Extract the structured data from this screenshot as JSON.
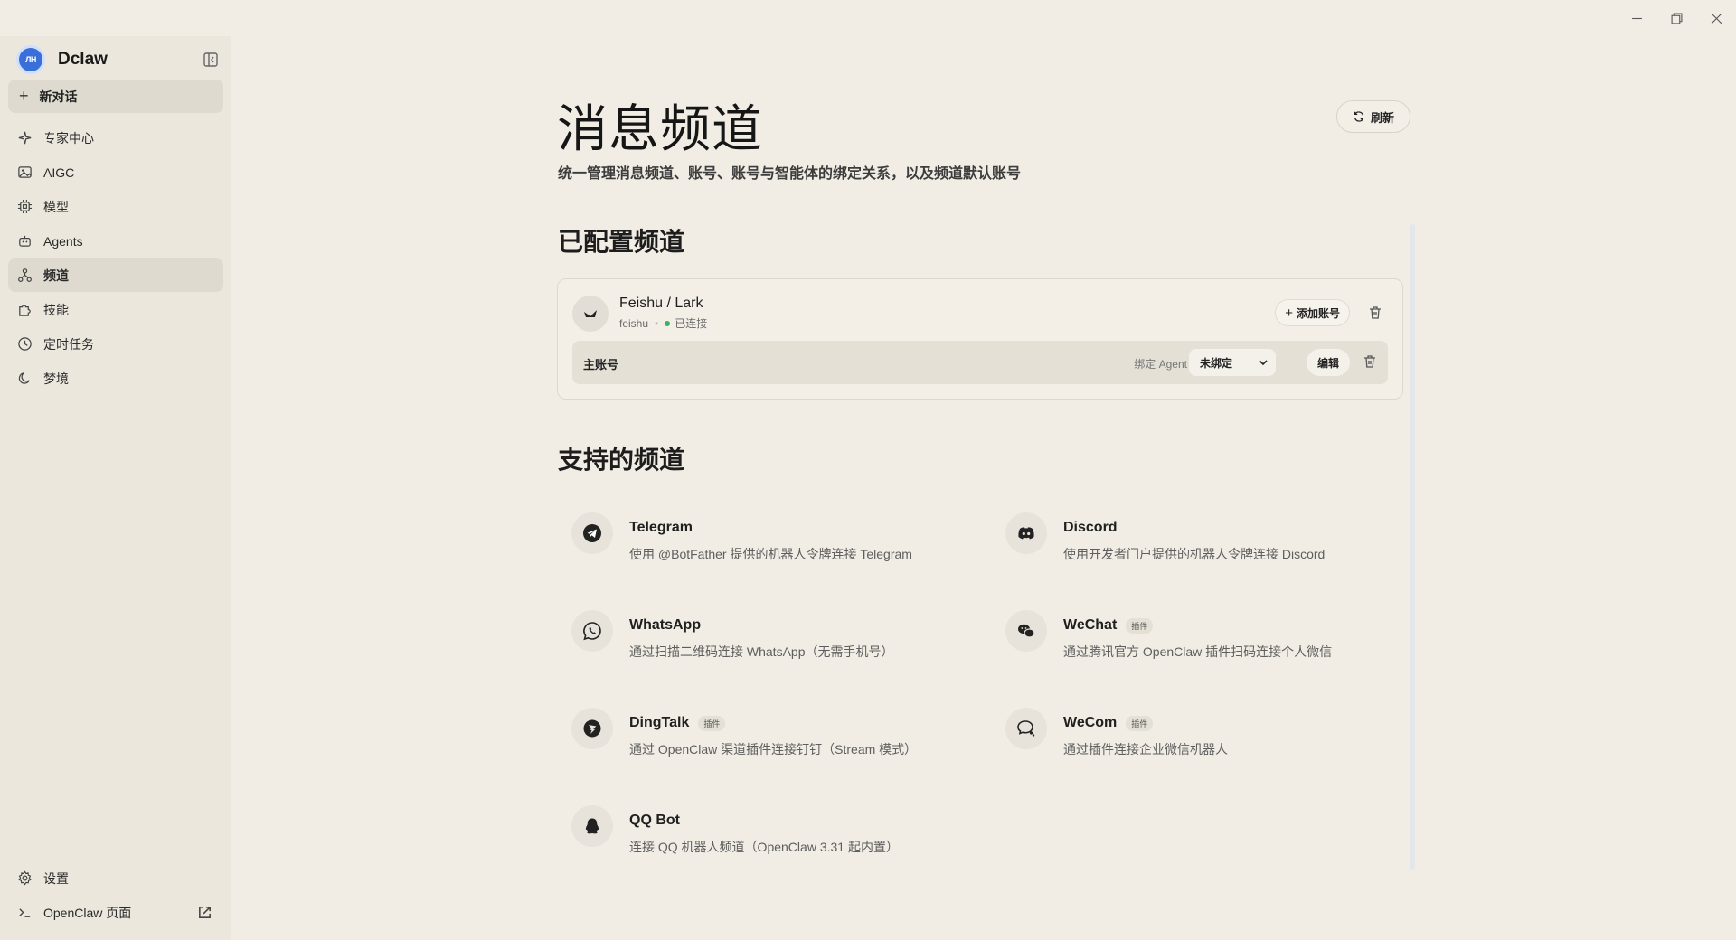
{
  "app": {
    "name": "Dclaw",
    "logo_text": "ЛН"
  },
  "sidebar": {
    "new_chat": "新对话",
    "items": [
      {
        "label": "专家中心",
        "icon": "sparkle-icon"
      },
      {
        "label": "AIGC",
        "icon": "image-icon"
      },
      {
        "label": "模型",
        "icon": "chip-icon"
      },
      {
        "label": "Agents",
        "icon": "robot-icon"
      },
      {
        "label": "频道",
        "icon": "network-icon",
        "active": true
      },
      {
        "label": "技能",
        "icon": "puzzle-icon"
      },
      {
        "label": "定时任务",
        "icon": "clock-icon"
      },
      {
        "label": "梦境",
        "icon": "moon-icon"
      }
    ],
    "bottom": {
      "settings": "设置",
      "openclaw": "OpenClaw 页面"
    }
  },
  "header": {
    "title": "消息频道",
    "subtitle": "统一管理消息频道、账号、账号与智能体的绑定关系，以及频道默认账号",
    "refresh": "刷新"
  },
  "configured": {
    "section_title": "已配置频道",
    "channel": {
      "name": "Feishu / Lark",
      "id": "feishu",
      "status": "已连接",
      "status_color": "#36b463",
      "add_account": "添加账号",
      "account": {
        "name": "主账号",
        "bind_label": "绑定 Agent",
        "bind_value": "未绑定",
        "edit": "编辑"
      }
    }
  },
  "supported": {
    "section_title": "支持的频道",
    "channels": [
      {
        "name": "Telegram",
        "tag": "",
        "desc": "使用 @BotFather 提供的机器人令牌连接 Telegram",
        "icon": "telegram-icon"
      },
      {
        "name": "Discord",
        "tag": "",
        "desc": "使用开发者门户提供的机器人令牌连接 Discord",
        "icon": "discord-icon"
      },
      {
        "name": "WhatsApp",
        "tag": "",
        "desc": "通过扫描二维码连接 WhatsApp（无需手机号）",
        "icon": "whatsapp-icon"
      },
      {
        "name": "WeChat",
        "tag": "插件",
        "desc": "通过腾讯官方 OpenClaw 插件扫码连接个人微信",
        "icon": "wechat-icon"
      },
      {
        "name": "DingTalk",
        "tag": "插件",
        "desc": "通过 OpenClaw 渠道插件连接钉钉（Stream 模式）",
        "icon": "dingtalk-icon"
      },
      {
        "name": "WeCom",
        "tag": "插件",
        "desc": "通过插件连接企业微信机器人",
        "icon": "wecom-icon"
      },
      {
        "name": "QQ Bot",
        "tag": "",
        "desc": "连接 QQ 机器人频道（OpenClaw 3.31 起内置）",
        "icon": "qq-icon"
      }
    ]
  }
}
